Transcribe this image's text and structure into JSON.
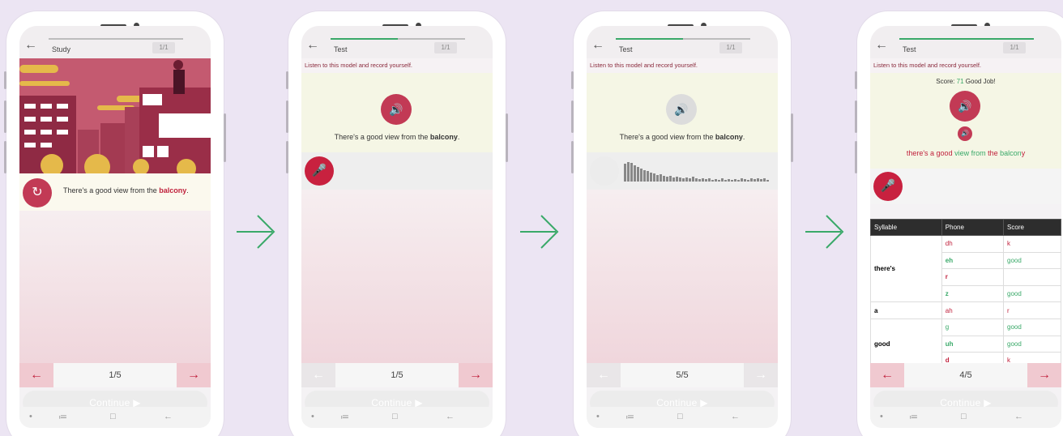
{
  "colors": {
    "accent": "#c23a55",
    "green": "#3aa969",
    "background": "#ece5f3"
  },
  "screens": [
    {
      "title": "Study",
      "count": "1/1",
      "sentence_pre": "There's a good view from the ",
      "sentence_word": "balcony",
      "sentence_post": ".",
      "page": "1/5",
      "continue": "Continue"
    },
    {
      "title": "Test",
      "count": "1/1",
      "progress": 0.5,
      "instruction": "Listen to this model and record yourself.",
      "sentence_pre": "There's a good view from the ",
      "sentence_word": "balcony",
      "sentence_post": ".",
      "page": "1/5",
      "continue": "Continue"
    },
    {
      "title": "Test",
      "count": "1/1",
      "progress": 0.5,
      "instruction": "Listen to this model and record yourself.",
      "sentence_pre": "There's a good view from the ",
      "sentence_word": "balcony",
      "sentence_post": ".",
      "page": "5/5",
      "continue": "Continue"
    },
    {
      "title": "Test",
      "count": "1/1",
      "progress": 1.0,
      "instruction": "Listen to this model and record yourself.",
      "score_label": "Score:",
      "score_value": "71",
      "score_text": "Good Job!",
      "words": [
        "there's a good",
        "view from",
        "the",
        "balcon",
        "y"
      ],
      "page": "4/5",
      "continue": "Continue",
      "table": {
        "headers": [
          "Syllable",
          "Phone",
          "Score"
        ],
        "rows": [
          [
            "there's",
            "dh",
            "k"
          ],
          [
            "",
            "eh",
            "good"
          ],
          [
            "",
            "r",
            ""
          ],
          [
            "",
            "z",
            "good"
          ],
          [
            "a",
            "ah",
            "r"
          ],
          [
            "good",
            "g",
            "good"
          ],
          [
            "",
            "uh",
            "good"
          ],
          [
            "",
            "d",
            "k"
          ]
        ]
      }
    }
  ],
  "icons": [
    "back-arrow-icon",
    "speaker-icon",
    "microphone-icon",
    "replay-icon",
    "arrow-left-icon",
    "arrow-right-icon",
    "play-circle-icon",
    "recent-apps-icon",
    "home-icon",
    "back-icon"
  ]
}
